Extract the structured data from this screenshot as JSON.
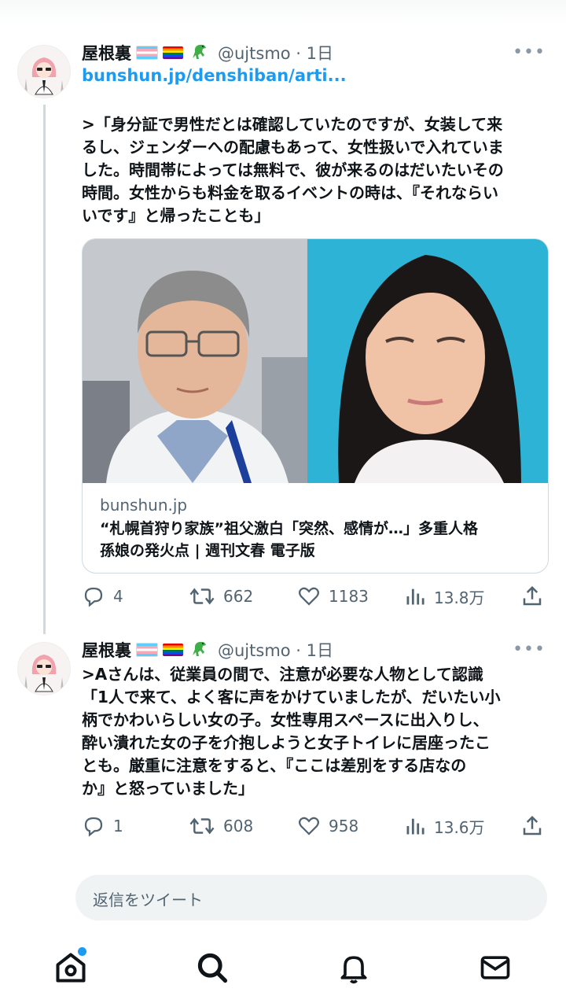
{
  "tweets": [
    {
      "name": "屋根裏",
      "handle": "@ujtsmo · 1日",
      "dino_icon": "🦖",
      "link": "bunshun.jp/denshiban/arti...",
      "body_lines": [
        ">「身分証で男性だとは確認していたのですが、女装して来",
        "るし、ジェンダーへの配慮もあって、女性扱いで入れていま",
        "した。時間帯によっては無料で、彼が来るのはだいたいその",
        "時間。女性からも料金を取るイベントの時は、『それならい",
        "いです』と帰ったことも」"
      ],
      "card": {
        "domain": "bunshun.jp",
        "title_lines": [
          "“札幌首狩り家族”祖父激白「突然、感情が…」多重人格",
          "孫娘の発火点 | 週刊文春 電子版"
        ]
      },
      "stats": {
        "replies": "4",
        "retweets": "662",
        "likes": "1183",
        "views": "13.8万"
      }
    },
    {
      "name": "屋根裏",
      "handle": "@ujtsmo · 1日",
      "dino_icon": "🦖",
      "body_lines": [
        ">Aさんは、従業員の間で、注意が必要な人物として認識",
        "「1人で来て、よく客に声をかけていましたが、だいたい小",
        "柄でかわいらしい女の子。女性専用スペースに出入りし、",
        "酔い潰れた女の子を介抱しようと女子トイレに居座ったこ",
        "とも。厳重に注意をすると、『ここは差別をする店なの",
        "か』と怒っていました」"
      ],
      "stats": {
        "replies": "1",
        "retweets": "608",
        "likes": "958",
        "views": "13.6万"
      }
    }
  ],
  "reply_box": {
    "placeholder": "返信をツイート"
  },
  "tabbar": {
    "items": [
      "home-icon",
      "search-icon",
      "notifications-icon",
      "messages-icon"
    ],
    "home_badge": true
  },
  "colors": {
    "accent": "#1d9bf0",
    "muted": "#536471",
    "text": "#0f1419"
  }
}
